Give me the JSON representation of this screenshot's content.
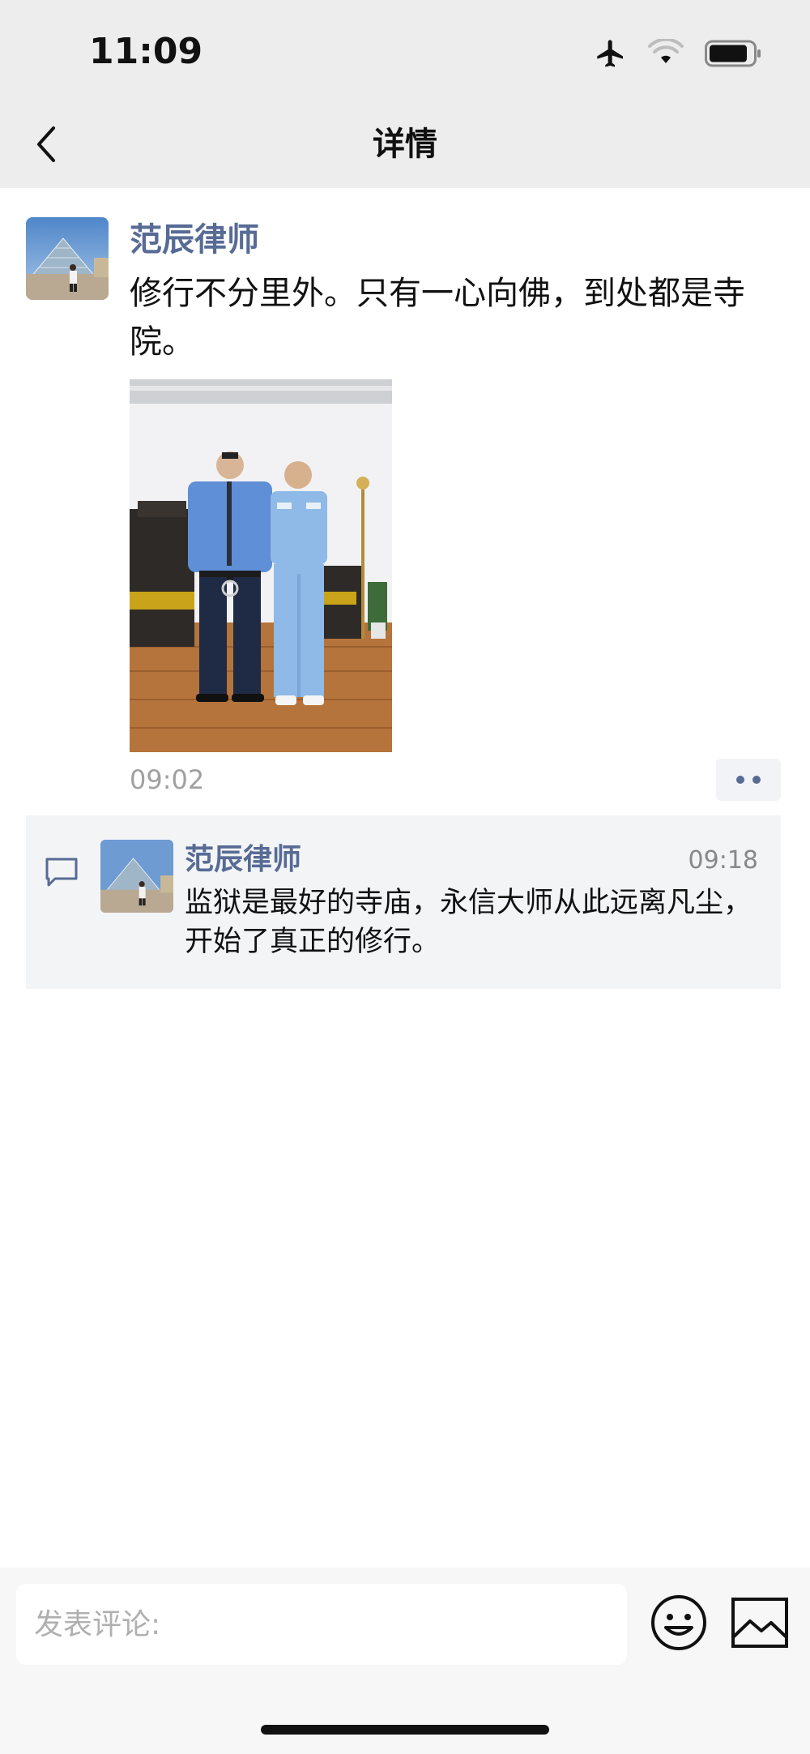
{
  "status_bar": {
    "time": "11:09",
    "icons": [
      "airplane-icon",
      "wifi-icon",
      "battery-icon"
    ]
  },
  "nav": {
    "back_icon": "chevron-left-icon",
    "title": "详情"
  },
  "post": {
    "author": "范辰律师",
    "text": "修行不分里外。只有一心向佛，到处都是寺院。",
    "time": "09:02",
    "more_icon": "more-dots-icon"
  },
  "comments": [
    {
      "author": "范辰律师",
      "time": "09:18",
      "text": "监狱是最好的寺庙，永信大师从此远离凡尘，开始了真正的修行。"
    }
  ],
  "input": {
    "placeholder": "发表评论:",
    "value": ""
  },
  "toolbar_icons": [
    "emoji-icon",
    "image-icon"
  ],
  "colors": {
    "name_link": "#576b95",
    "nav_bg": "#ededed",
    "comment_bg": "#f3f4f6"
  }
}
